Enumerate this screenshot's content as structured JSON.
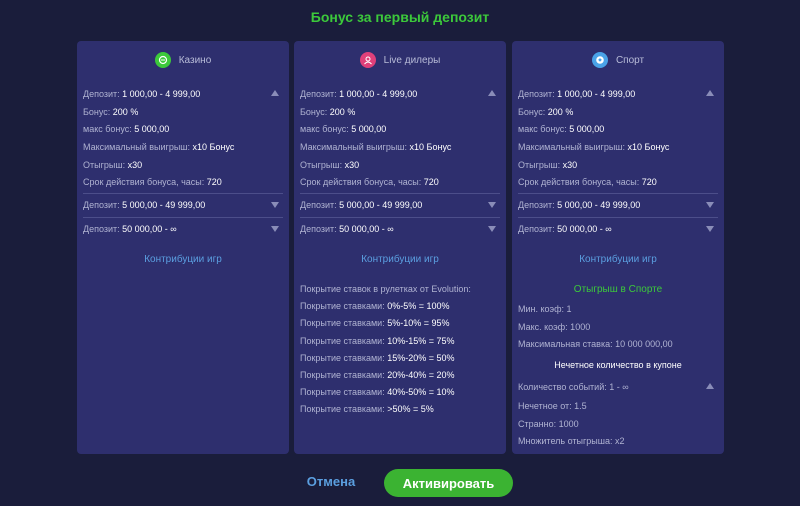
{
  "title": "Бонус за первый депозит",
  "cards": [
    {
      "name": "Казино",
      "icon": "casino-chip-icon",
      "icon_color": "#3cc93b",
      "tier1": {
        "deposit_label": "Депозит:",
        "deposit_value": "1 000,00    - 4 999,00",
        "bonus_label": "Бонус:",
        "bonus_value": "200 %",
        "max_bonus_label": "макс бонус:",
        "max_bonus_value": "5 000,00",
        "max_win_label": "Максимальный выигрыш:",
        "max_win_value": "x10 Бонус",
        "wager_label": "Отыгрыш:",
        "wager_value": "x30",
        "validity_label": "Срок действия бонуса, часы:",
        "validity_value": "720"
      },
      "tier2": {
        "label": "Депозит:",
        "value": "5 000,00    - 49 999,00"
      },
      "tier3": {
        "label": "Депозит:",
        "value": "50 000,00    - ∞"
      },
      "contrib": "Контрибуции игр"
    },
    {
      "name": "Live дилеры",
      "icon": "live-dealer-icon",
      "icon_color": "#e0407a",
      "tier1": {
        "deposit_label": "Депозит:",
        "deposit_value": "1 000,00    - 4 999,00",
        "bonus_label": "Бонус:",
        "bonus_value": "200 %",
        "max_bonus_label": "макс бонус:",
        "max_bonus_value": "5 000,00",
        "max_win_label": "Максимальный выигрыш:",
        "max_win_value": "x10 Бонус",
        "wager_label": "Отыгрыш:",
        "wager_value": "x30",
        "validity_label": "Срок действия бонуса, часы:",
        "validity_value": "720"
      },
      "tier2": {
        "label": "Депозит:",
        "value": "5 000,00    - 49 999,00"
      },
      "tier3": {
        "label": "Депозит:",
        "value": "50 000,00    - ∞"
      },
      "contrib": "Контрибуции игр",
      "coverage_heading": "Покрытие ставок в рулетках от Evolution:",
      "coverage": [
        {
          "label": "Покрытие ставками:",
          "value": "0%-5% = 100%"
        },
        {
          "label": "Покрытие ставками:",
          "value": "5%-10% = 95%"
        },
        {
          "label": "Покрытие ставками:",
          "value": "10%-15% = 75%"
        },
        {
          "label": "Покрытие ставками:",
          "value": "15%-20% = 50%"
        },
        {
          "label": "Покрытие ставками:",
          "value": "20%-40% = 20%"
        },
        {
          "label": "Покрытие ставками:",
          "value": "40%-50% = 10%"
        },
        {
          "label": "Покрытие ставками:",
          "value": ">50% = 5%"
        }
      ]
    },
    {
      "name": "Спорт",
      "icon": "soccer-ball-icon",
      "icon_color": "#4aa3e8",
      "tier1": {
        "deposit_label": "Депозит:",
        "deposit_value": "1 000,00    - 4 999,00",
        "bonus_label": "Бонус:",
        "bonus_value": "200 %",
        "max_bonus_label": "макс бонус:",
        "max_bonus_value": "5 000,00",
        "max_win_label": "Максимальный выигрыш:",
        "max_win_value": "x10 Бонус",
        "wager_label": "Отыгрыш:",
        "wager_value": "x30",
        "validity_label": "Срок действия бонуса, часы:",
        "validity_value": "720"
      },
      "tier2": {
        "label": "Депозит:",
        "value": "5 000,00    - 49 999,00"
      },
      "tier3": {
        "label": "Депозит:",
        "value": "50 000,00    - ∞"
      },
      "contrib": "Контрибуции игр",
      "sport_wager_heading": "Отыгрыш в Спорте",
      "min_coef": "Мин. коэф: 1",
      "max_coef": "Макс. коэф: 1000",
      "max_stake": "Максимальная ставка: 10 000 000,00",
      "odd_heading": "Нечетное количество в купоне",
      "events": "Количество событий: 1 - ∞",
      "odd_from": "Нечетное от: 1.5",
      "strange": "Странно: 1000",
      "multiplier": "Множитель отыгрыша: x2"
    }
  ],
  "buttons": {
    "cancel": "Отмена",
    "activate": "Активировать"
  },
  "colors": {
    "accent_green": "#3cc93b",
    "link_blue": "#5b9fe0",
    "card_bg": "#2e2f6e",
    "page_bg": "#1a1d3b"
  }
}
